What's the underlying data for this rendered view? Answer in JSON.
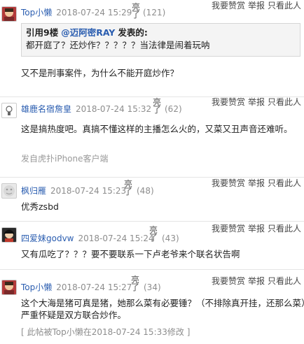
{
  "actions": {
    "report": "我要赞赏",
    "flag": "举报",
    "only_this": "只看此人"
  },
  "posts": [
    {
      "user": "Top小懒",
      "date": "2018-07-24 15:29",
      "like_label": "亮了",
      "like_count": "(121)",
      "quote": {
        "prefix": "引用9楼",
        "at": "@迈阿密RAY",
        "suffix": "发表的:",
        "text": "都开庭了？还炒作？？？？？当法律是闹着玩呐"
      },
      "text": "又不是刑事案件，为什么不能开庭炒作？"
    },
    {
      "user": "雄鹿名宿詹皇",
      "date": "2018-07-24 15:32",
      "like_label": "亮了",
      "like_count": "(62)",
      "text": "这是搞热度吧。真搞不懂这样的主播怎么火的，又菜又丑声音还难听。",
      "source": "发自虎扑iPhone客户端"
    },
    {
      "user": "枫归雁",
      "date": "2018-07-24 15:23",
      "like_label": "亮了",
      "like_count": "(48)",
      "text": "优秀zsbd"
    },
    {
      "user": "四爱妹godvw",
      "date": "2018-07-24 15:24",
      "like_label": "亮了",
      "like_count": "(43)",
      "text": "又有瓜吃了？？？要不要联系一下卢老爷来个联名状告啊"
    },
    {
      "user": "Top小懒",
      "date": "2018-07-24 15:27",
      "like_label": "亮了",
      "like_count": "(34)",
      "text1": "这个大海是猪可真是猪，她那么菜有必要锤？（不排除真开挂，还那么菜）",
      "text2": "严重怀疑是双方联合炒作。",
      "edit_note": "[ 此帖被Top小懒在2018-07-24 15:33修改 ]"
    }
  ]
}
